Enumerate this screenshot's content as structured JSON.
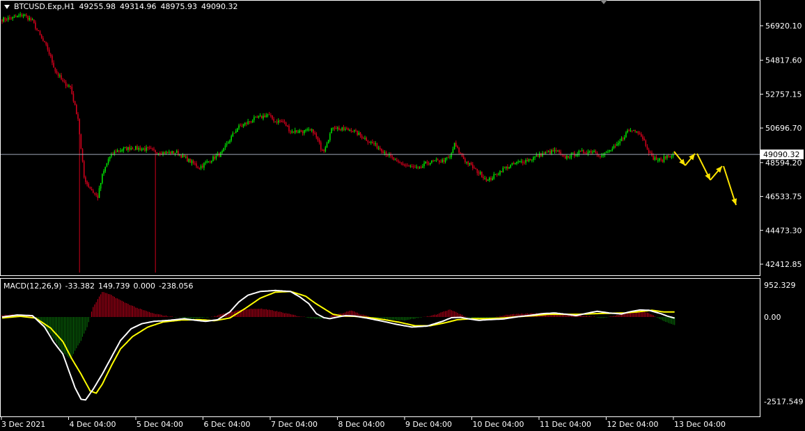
{
  "header": {
    "symbol": "BTCUSD.Exp,H1",
    "open": "49255.98",
    "high": "49314.96",
    "low": "48975.93",
    "close": "49090.32"
  },
  "macd_header": {
    "name": "MACD(12,26,9)",
    "values": [
      "-33.382",
      "149.739",
      "0.000",
      "-238.056"
    ]
  },
  "colors": {
    "bull": "#00e000",
    "bear": "#d0001c",
    "signal": "#ffff00",
    "macd_line": "#ffffff",
    "frame": "#ffffff",
    "price_line": "#9fa8b8",
    "arrows": "#ffe500"
  },
  "chart_data": [
    {
      "type": "candlestick",
      "title": "BTCUSD.Exp,H1",
      "ylim": [
        41700,
        58300
      ],
      "y_ticks": [
        "56920.10",
        "54817.60",
        "52757.15",
        "50696.70",
        "48594.20",
        "46533.75",
        "44473.30",
        "42412.85"
      ],
      "current_price_label": "49090.32",
      "x_tick_labels": [
        "3 Dec 2021",
        "4 Dec 04:00",
        "5 Dec 04:00",
        "6 Dec 04:00",
        "7 Dec 04:00",
        "8 Dec 04:00",
        "9 Dec 04:00",
        "10 Dec 04:00",
        "11 Dec 04:00",
        "12 Dec 04:00",
        "13 Dec 04:00"
      ],
      "close_anchors": [
        [
          0,
          57300
        ],
        [
          8,
          57400
        ],
        [
          14,
          57600
        ],
        [
          20,
          57200
        ],
        [
          25,
          56300
        ],
        [
          30,
          55500
        ],
        [
          35,
          54200
        ],
        [
          40,
          53500
        ],
        [
          45,
          53200
        ],
        [
          48,
          52000
        ],
        [
          50,
          51300
        ],
        [
          52,
          49400
        ],
        [
          54,
          47700
        ],
        [
          56,
          47300
        ],
        [
          60,
          46800
        ],
        [
          63,
          46500
        ],
        [
          66,
          47800
        ],
        [
          70,
          48800
        ],
        [
          75,
          49300
        ],
        [
          85,
          49500
        ],
        [
          95,
          49400
        ],
        [
          105,
          49200
        ],
        [
          115,
          49200
        ],
        [
          125,
          48600
        ],
        [
          130,
          48300
        ],
        [
          138,
          48800
        ],
        [
          145,
          49200
        ],
        [
          150,
          50000
        ],
        [
          155,
          50700
        ],
        [
          165,
          51200
        ],
        [
          175,
          51500
        ],
        [
          180,
          51100
        ],
        [
          185,
          51100
        ],
        [
          190,
          50500
        ],
        [
          198,
          50500
        ],
        [
          205,
          50500
        ],
        [
          210,
          49500
        ],
        [
          212,
          49400
        ],
        [
          218,
          50800
        ],
        [
          223,
          50600
        ],
        [
          230,
          50600
        ],
        [
          240,
          50000
        ],
        [
          245,
          49700
        ],
        [
          250,
          49400
        ],
        [
          260,
          48600
        ],
        [
          270,
          48300
        ],
        [
          275,
          48200
        ],
        [
          280,
          48600
        ],
        [
          290,
          48700
        ],
        [
          295,
          48900
        ],
        [
          298,
          49700
        ],
        [
          300,
          49400
        ],
        [
          305,
          48700
        ],
        [
          310,
          48300
        ],
        [
          315,
          47900
        ],
        [
          320,
          47500
        ],
        [
          330,
          48200
        ],
        [
          340,
          48600
        ],
        [
          348,
          48800
        ],
        [
          355,
          49100
        ],
        [
          365,
          49300
        ],
        [
          370,
          48900
        ],
        [
          380,
          49200
        ],
        [
          390,
          49300
        ],
        [
          395,
          49000
        ],
        [
          405,
          49600
        ],
        [
          412,
          50500
        ],
        [
          418,
          50600
        ],
        [
          422,
          50100
        ],
        [
          428,
          48900
        ],
        [
          434,
          48700
        ],
        [
          438,
          49000
        ],
        [
          443,
          49090
        ]
      ],
      "spikes": [
        [
          101,
          41900
        ],
        [
          51,
          41900
        ]
      ],
      "forecast_arrows": [
        [
          [
            968,
            218
          ],
          [
            984,
            238
          ]
        ],
        [
          [
            984,
            238
          ],
          [
            998,
            221
          ]
        ],
        [
          [
            1001,
            221
          ],
          [
            1020,
            259
          ]
        ],
        [
          [
            1020,
            259
          ],
          [
            1037,
            239
          ]
        ],
        [
          [
            1039,
            239
          ],
          [
            1057,
            295
          ]
        ]
      ]
    },
    {
      "type": "line",
      "title": "MACD(12,26,9)",
      "ylim": [
        -2560,
        1000
      ],
      "y_ticks": [
        "952.329",
        "0.00",
        "-2517.549"
      ],
      "series": [
        {
          "name": "MACD",
          "kind": "histogram",
          "anchors": [
            [
              0,
              50
            ],
            [
              10,
              80
            ],
            [
              20,
              50
            ],
            [
              25,
              -100
            ],
            [
              32,
              -500
            ],
            [
              40,
              -1050
            ],
            [
              45,
              -1250
            ],
            [
              52,
              -700
            ],
            [
              56,
              -300
            ],
            [
              60,
              300
            ],
            [
              66,
              750
            ],
            [
              72,
              650
            ],
            [
              80,
              450
            ],
            [
              90,
              250
            ],
            [
              100,
              100
            ],
            [
              110,
              20
            ],
            [
              125,
              -60
            ],
            [
              140,
              20
            ],
            [
              150,
              150
            ],
            [
              160,
              230
            ],
            [
              170,
              250
            ],
            [
              180,
              180
            ],
            [
              195,
              30
            ],
            [
              205,
              -40
            ],
            [
              212,
              -50
            ],
            [
              218,
              70
            ],
            [
              225,
              120
            ],
            [
              230,
              200
            ],
            [
              236,
              80
            ],
            [
              245,
              -20
            ],
            [
              255,
              -70
            ],
            [
              265,
              -100
            ],
            [
              275,
              -20
            ],
            [
              285,
              60
            ],
            [
              290,
              150
            ],
            [
              295,
              220
            ],
            [
              300,
              120
            ],
            [
              308,
              -40
            ],
            [
              316,
              -90
            ],
            [
              325,
              0
            ],
            [
              333,
              70
            ],
            [
              342,
              90
            ],
            [
              350,
              110
            ],
            [
              360,
              130
            ],
            [
              368,
              80
            ],
            [
              377,
              50
            ],
            [
              388,
              20
            ],
            [
              396,
              -30
            ],
            [
              404,
              40
            ],
            [
              412,
              140
            ],
            [
              420,
              200
            ],
            [
              428,
              80
            ],
            [
              436,
              -130
            ],
            [
              443,
              -238
            ]
          ]
        },
        {
          "name": "MACD",
          "kind": "line",
          "anchors": [
            [
              0,
              0
            ],
            [
              10,
              60
            ],
            [
              20,
              40
            ],
            [
              28,
              -300
            ],
            [
              34,
              -750
            ],
            [
              40,
              -1100
            ],
            [
              44,
              -1600
            ],
            [
              48,
              -2100
            ],
            [
              52,
              -2450
            ],
            [
              55,
              -2470
            ],
            [
              60,
              -2150
            ],
            [
              66,
              -1700
            ],
            [
              72,
              -1200
            ],
            [
              78,
              -700
            ],
            [
              85,
              -350
            ],
            [
              92,
              -200
            ],
            [
              100,
              -130
            ],
            [
              110,
              -100
            ],
            [
              120,
              -50
            ],
            [
              126,
              -90
            ],
            [
              134,
              -130
            ],
            [
              142,
              -80
            ],
            [
              150,
              150
            ],
            [
              156,
              450
            ],
            [
              162,
              650
            ],
            [
              170,
              760
            ],
            [
              180,
              790
            ],
            [
              190,
              760
            ],
            [
              196,
              600
            ],
            [
              202,
              400
            ],
            [
              207,
              100
            ],
            [
              212,
              -20
            ],
            [
              216,
              -50
            ],
            [
              220,
              -10
            ],
            [
              226,
              40
            ],
            [
              232,
              30
            ],
            [
              240,
              -30
            ],
            [
              250,
              -120
            ],
            [
              260,
              -220
            ],
            [
              270,
              -300
            ],
            [
              280,
              -270
            ],
            [
              290,
              -130
            ],
            [
              296,
              -20
            ],
            [
              302,
              -10
            ],
            [
              308,
              -60
            ],
            [
              314,
              -100
            ],
            [
              320,
              -80
            ],
            [
              330,
              -60
            ],
            [
              340,
              10
            ],
            [
              348,
              50
            ],
            [
              356,
              100
            ],
            [
              364,
              120
            ],
            [
              372,
              80
            ],
            [
              378,
              40
            ],
            [
              385,
              110
            ],
            [
              392,
              170
            ],
            [
              400,
              120
            ],
            [
              408,
              90
            ],
            [
              414,
              160
            ],
            [
              420,
              210
            ],
            [
              426,
              200
            ],
            [
              434,
              100
            ],
            [
              438,
              30
            ],
            [
              443,
              -33
            ]
          ]
        },
        {
          "name": "Signal",
          "kind": "line",
          "anchors": [
            [
              0,
              -30
            ],
            [
              12,
              20
            ],
            [
              22,
              -30
            ],
            [
              32,
              -330
            ],
            [
              40,
              -730
            ],
            [
              46,
              -1250
            ],
            [
              52,
              -1700
            ],
            [
              58,
              -2200
            ],
            [
              62,
              -2270
            ],
            [
              66,
              -2000
            ],
            [
              72,
              -1450
            ],
            [
              78,
              -950
            ],
            [
              86,
              -580
            ],
            [
              96,
              -300
            ],
            [
              106,
              -150
            ],
            [
              118,
              -90
            ],
            [
              130,
              -80
            ],
            [
              140,
              -110
            ],
            [
              150,
              -30
            ],
            [
              160,
              250
            ],
            [
              170,
              560
            ],
            [
              180,
              740
            ],
            [
              190,
              760
            ],
            [
              200,
              620
            ],
            [
              206,
              420
            ],
            [
              212,
              250
            ],
            [
              218,
              80
            ],
            [
              224,
              30
            ],
            [
              232,
              20
            ],
            [
              242,
              -20
            ],
            [
              252,
              -80
            ],
            [
              262,
              -160
            ],
            [
              272,
              -260
            ],
            [
              282,
              -260
            ],
            [
              292,
              -170
            ],
            [
              300,
              -80
            ],
            [
              310,
              -50
            ],
            [
              320,
              -50
            ],
            [
              330,
              -30
            ],
            [
              340,
              10
            ],
            [
              350,
              40
            ],
            [
              360,
              80
            ],
            [
              370,
              80
            ],
            [
              380,
              80
            ],
            [
              390,
              100
            ],
            [
              400,
              110
            ],
            [
              410,
              120
            ],
            [
              420,
              160
            ],
            [
              428,
              200
            ],
            [
              436,
              150
            ],
            [
              443,
              150
            ]
          ]
        }
      ]
    }
  ]
}
